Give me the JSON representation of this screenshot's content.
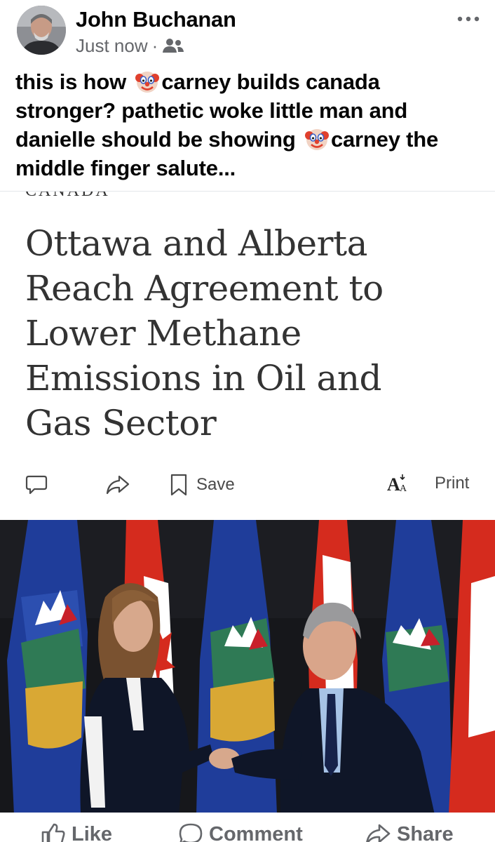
{
  "post": {
    "author": "John Buchanan",
    "timestamp": "Just now",
    "separator": "·",
    "audience_icon": "friends-icon",
    "more_icon": "more-horizontal-icon",
    "text_lines": [
      {
        "before": "this is how ",
        "emoji": "clown-face-emoji",
        "after": "carney builds canada"
      },
      {
        "before": "stronger? pathetic woke little man and",
        "emoji": null,
        "after": ""
      },
      {
        "before": "danielle should be showing ",
        "emoji": "clown-face-emoji",
        "after": "carney the"
      },
      {
        "before": "middle finger salute...",
        "emoji": null,
        "after": ""
      }
    ]
  },
  "article": {
    "section": "CANADA",
    "headline_lines": [
      "Ottawa and Alberta",
      "Reach Agreement to",
      "Lower Methane",
      "Emissions in Oil and",
      "Gas Sector"
    ],
    "tools": {
      "comment_icon": "comment-bubble-icon",
      "share_icon": "share-arrow-icon",
      "save_icon": "bookmark-icon",
      "save_label": "Save",
      "text_size_icon": "text-size-icon",
      "print_label": "Print"
    },
    "photo_alt": "photo-of-handshake-in-front-of-flags"
  },
  "actions": {
    "like_label": "Like",
    "comment_label": "Comment",
    "share_label": "Share"
  },
  "colors": {
    "text_primary": "#050505",
    "text_secondary": "#65676b",
    "headline": "#333333",
    "alberta_blue": "#1f3d9a",
    "canada_red": "#d52b1e"
  }
}
